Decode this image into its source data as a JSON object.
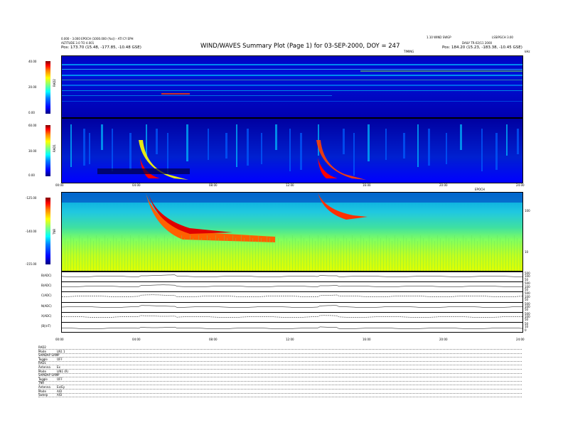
{
  "header": {
    "title": "WIND/WAVES Summary Plot (Page 1) for 03-SEP-2000, DOY = 247",
    "left_line1": "0.000 - 3.000 EPOCH (1000.000 (%s)) - ATI CY EPH",
    "left_line2": "ALTITUDE 3.0 TO 4.001",
    "left_line3": "Pos: 173.70 (15.48, -177.85, -10.48 GSE)",
    "right_line1": "1.10 WIND SWGP",
    "right_line2": "DAILY TR-02(11 2000",
    "right_line3": "Pos: 184.20 (15.23, -183.38, -10.45 GSE)",
    "right_corner": "LSSIPGCH 3.00",
    "timing_label": "TIMING",
    "khz_label": "kHz",
    "mhz_label": "MHz"
  },
  "panels": {
    "rad2": {
      "label": "RAD2",
      "ticks": [
        "40.00",
        "20.00",
        "0.00"
      ]
    },
    "rad1": {
      "label": "RAD1",
      "ticks": [
        "60.00",
        "30.00",
        "0.00"
      ]
    },
    "tnr": {
      "label": "TNR",
      "ticks": [
        "-125.00",
        "-140.00",
        "-155.00"
      ],
      "right_ticks": [
        "100",
        "10"
      ]
    },
    "line_plots": [
      {
        "label": "B(ADC)",
        "right_ticks": [
          "500",
          "100",
          "50"
        ]
      },
      {
        "label": "B(ADC)",
        "right_ticks": [
          "500",
          "100",
          "50"
        ]
      },
      {
        "label": "C(ADC)",
        "right_ticks": [
          "500",
          "100",
          "50"
        ]
      },
      {
        "label": "N(ADC)",
        "right_ticks": [
          "500",
          "100",
          "50"
        ]
      },
      {
        "label": "X(ADC)",
        "right_ticks": [
          "500",
          "100",
          "50"
        ]
      },
      {
        "label": "|B|(nT)",
        "right_ticks": [
          "50",
          "10",
          "0"
        ]
      }
    ]
  },
  "time_axis": {
    "ticks": [
      "00:00",
      "04:00",
      "08:00",
      "12:00",
      "16:00",
      "20:00",
      "24:00"
    ],
    "tnr_label": "EPOCH"
  },
  "settings": {
    "rad2": {
      "heading": "RAD2",
      "rows": [
        [
          "Mode",
          "LN1 1"
        ],
        [
          "SAMDAP SAMP",
          ""
        ],
        [
          "Toggle",
          "OFF"
        ]
      ]
    },
    "rad1": {
      "heading": "RAD1",
      "rows": [
        [
          "Antenna",
          "Ex"
        ],
        [
          "Mode",
          "LIN1 (R)"
        ],
        [
          "SAMDAP SAMP",
          ""
        ],
        [
          "Toggle",
          "OFF"
        ]
      ]
    },
    "tnr": {
      "heading": "TNR",
      "rows": [
        [
          "Antenna",
          "Ex/Ey"
        ],
        [
          "Mode",
          "A/D"
        ],
        [
          "Sweep",
          "A/D"
        ]
      ]
    }
  },
  "chart_data": {
    "type": "heatmap",
    "title": "WIND/WAVES Summary Plot (Page 1) for 03-SEP-2000, DOY = 247",
    "x_range_hours": [
      0,
      24
    ],
    "x_ticks": [
      "00:00",
      "04:00",
      "08:00",
      "12:00",
      "16:00",
      "20:00",
      "24:00"
    ],
    "panels": [
      {
        "name": "RAD2",
        "ylim": [
          0,
          40
        ],
        "colorbar_ticks": [
          40,
          20,
          0
        ]
      },
      {
        "name": "RAD1",
        "ylim": [
          0,
          60
        ],
        "colorbar_ticks": [
          60,
          30,
          0
        ]
      },
      {
        "name": "TNR",
        "ylim": [
          -155,
          -125
        ],
        "colorbar_ticks": [
          -125,
          -140,
          -155
        ],
        "right_axis_ticks": [
          100,
          10
        ]
      }
    ],
    "events": [
      {
        "type": "type III burst (intense)",
        "start_hour": 4.2,
        "panels": [
          "RAD1",
          "TNR"
        ]
      },
      {
        "type": "type III burst (intense)",
        "start_hour": 13.2,
        "panels": [
          "RAD1",
          "TNR"
        ]
      }
    ],
    "colors": {
      "low": "#0000a0",
      "mid": "#00ffff",
      "high": "#ff0000"
    }
  }
}
